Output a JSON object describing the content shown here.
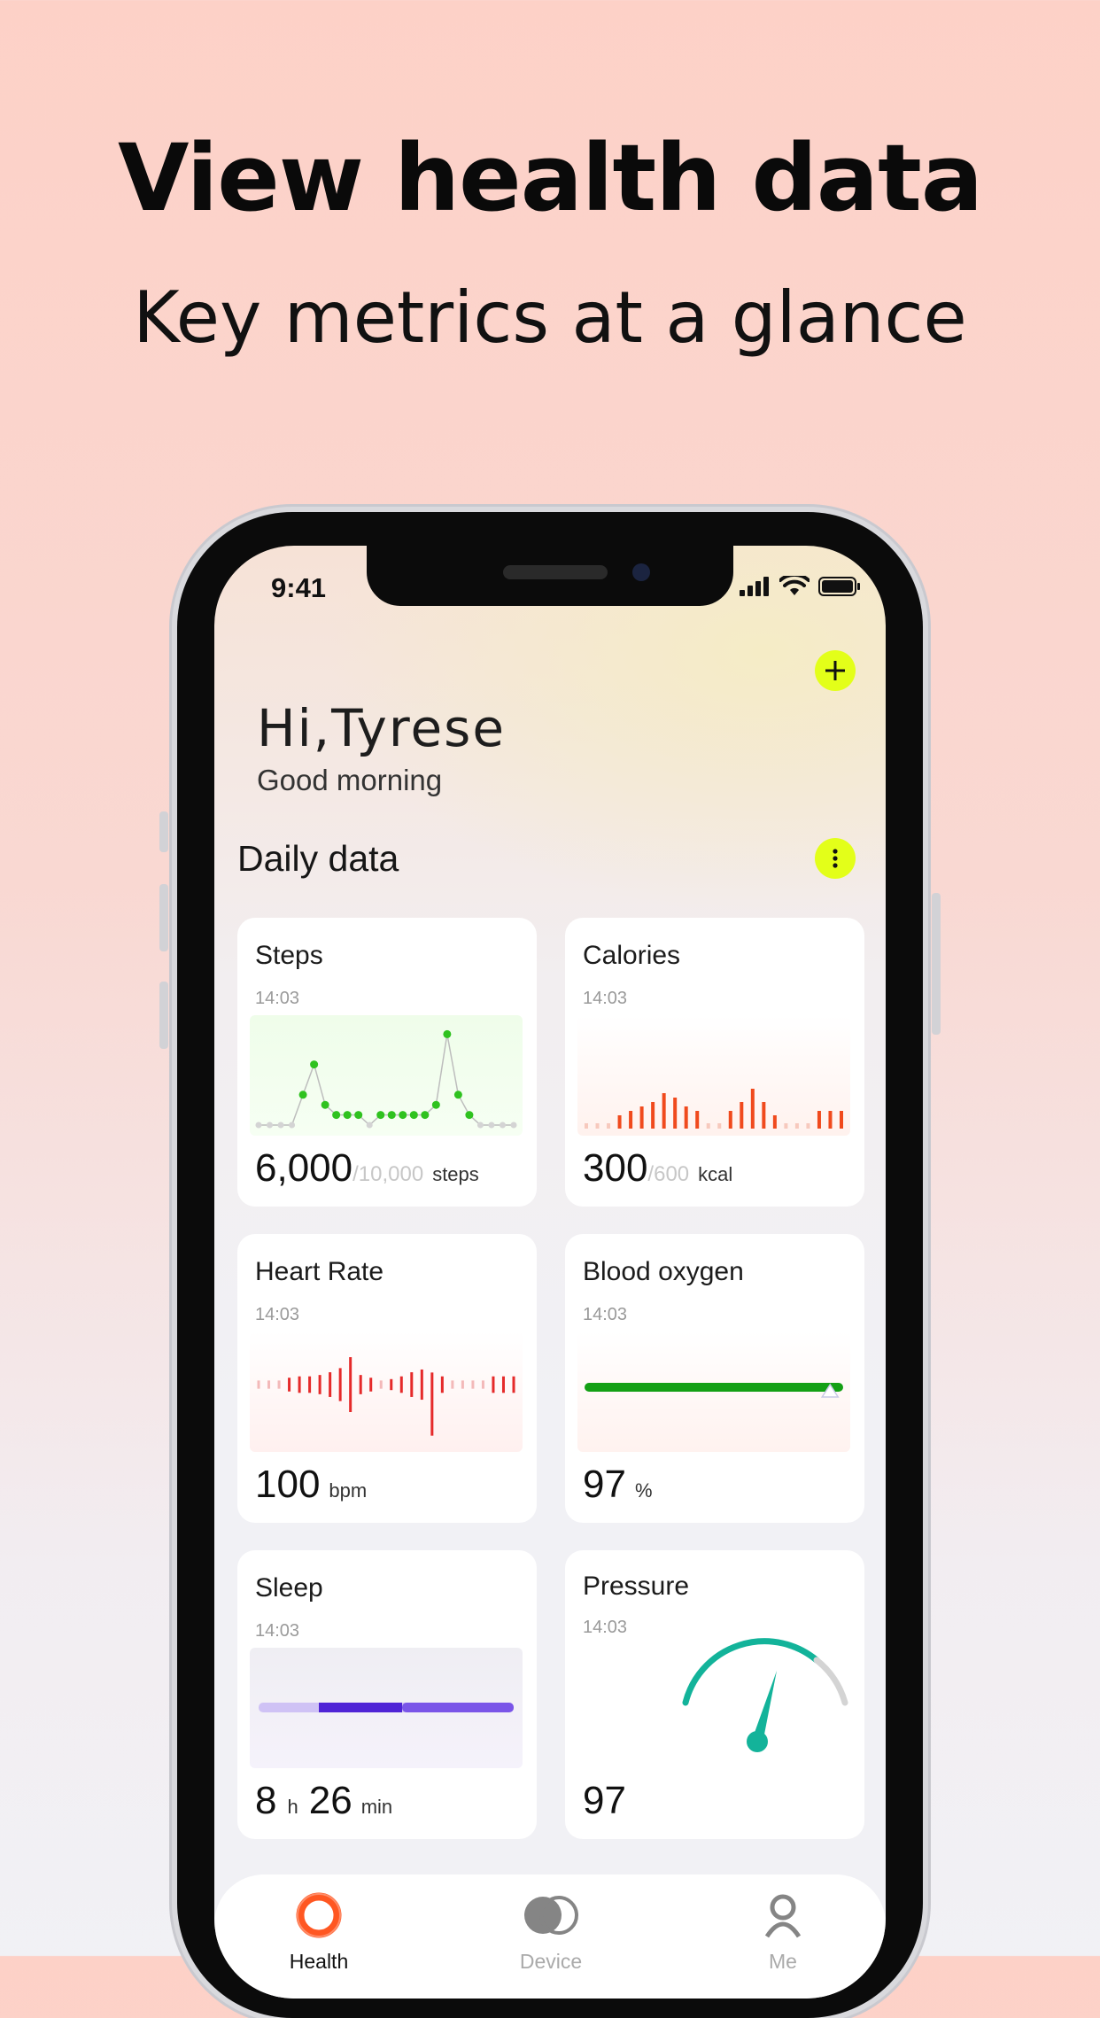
{
  "hero": {
    "title": "View health data",
    "subtitle": "Key metrics at a glance"
  },
  "status_bar": {
    "time": "9:41"
  },
  "greeting": {
    "name": "Hi,Tyrese",
    "message": "Good morning"
  },
  "section": {
    "title": "Daily data"
  },
  "cards": {
    "steps": {
      "title": "Steps",
      "time": "14:03",
      "value": "6,000",
      "goal": "/10,000",
      "unit": "steps",
      "chart_values": [
        0,
        0,
        0,
        0,
        0.3,
        0.6,
        0.2,
        0.1,
        0.1,
        0.1,
        0,
        0.1,
        0.1,
        0.1,
        0.1,
        0.1,
        0.2,
        0.9,
        0.3,
        0.1,
        0,
        0,
        0,
        0
      ]
    },
    "calories": {
      "title": "Calories",
      "time": "14:03",
      "value": "300",
      "goal": "/600",
      "unit": "kcal",
      "chart_values": [
        0.1,
        0.1,
        0.1,
        0.3,
        0.4,
        0.5,
        0.6,
        0.8,
        0.7,
        0.5,
        0.4,
        0.1,
        0.1,
        0.4,
        0.6,
        0.9,
        0.6,
        0.3,
        0.1,
        0.1,
        0.1,
        0.4,
        0.4,
        0.4
      ]
    },
    "heart_rate": {
      "title": "Heart Rate",
      "time": "14:03",
      "value": "100",
      "unit": "bpm",
      "chart_values": [
        0.15,
        0.15,
        0.15,
        0.25,
        0.3,
        0.3,
        0.35,
        0.45,
        0.6,
        1,
        0.35,
        0.25,
        0.15,
        0.2,
        0.3,
        0.45,
        0.55,
        1.15,
        0.3,
        0.15,
        0.15,
        0.15,
        0.15,
        0.3,
        0.3,
        0.3
      ]
    },
    "blood_oxygen": {
      "title": "Blood oxygen",
      "time": "14:03",
      "value": "97",
      "unit": "%",
      "level": 0.97
    },
    "sleep": {
      "title": "Sleep",
      "time": "14:03",
      "hours": "8",
      "hours_unit": "h",
      "minutes": "26",
      "minutes_unit": "min"
    },
    "pressure": {
      "title": "Pressure",
      "time": "14:03",
      "value": "97",
      "level": 0.8
    }
  },
  "tabs": [
    {
      "label": "Health",
      "active": true
    },
    {
      "label": "Device",
      "active": false
    },
    {
      "label": "Me",
      "active": false
    }
  ],
  "colors": {
    "accent_yellow": "#e3ff19",
    "steps_green": "#2fc21f",
    "calories_orange": "#f04a1d",
    "heart_red": "#e52a2a",
    "oxygen_green": "#14a015",
    "sleep_purple": "#5b2fe0",
    "pressure_teal": "#13b39a",
    "health_tab": "#ff5722"
  },
  "icons": {
    "plus": "plus-icon",
    "more": "more-vertical-icon",
    "health": "health-ring-icon",
    "device": "device-icon",
    "me": "user-icon"
  }
}
